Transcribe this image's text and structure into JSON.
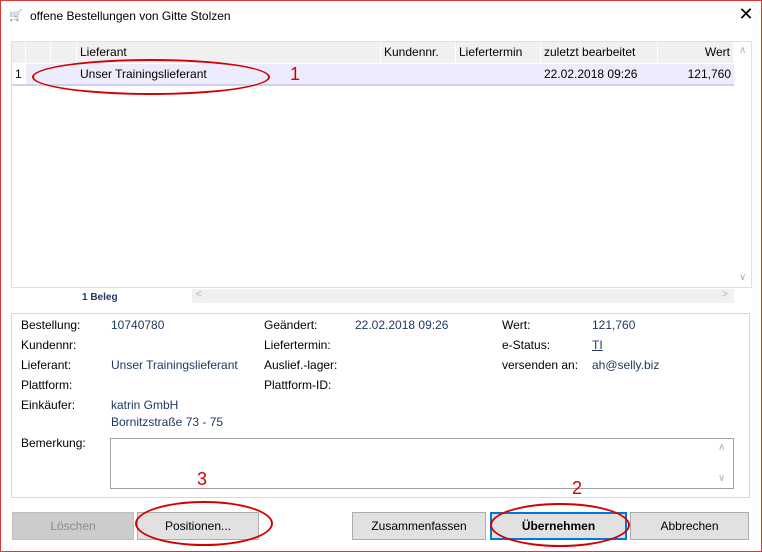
{
  "window": {
    "title": "offene Bestellungen von Gitte Stolzen",
    "close": "✕"
  },
  "grid": {
    "columns": [
      "Lieferant",
      "Kundennr.",
      "Liefertermin",
      "zuletzt bearbeitet",
      "Wert"
    ],
    "rows": [
      {
        "num": "1",
        "lieferant": "Unser Trainingslieferant",
        "kundennr": "",
        "liefertermin": "",
        "zuletzt": "22.02.2018 09:26",
        "wert": "121,760"
      }
    ],
    "count": "1 Beleg"
  },
  "details": {
    "bestellung_label": "Bestellung:",
    "bestellung": "10740780",
    "geaendert_label": "Geändert:",
    "geaendert": "22.02.2018 09:26",
    "wert_label": "Wert:",
    "wert": "121,760",
    "kundennr_label": "Kundennr:",
    "liefertermin_label": "Liefertermin:",
    "estatus_label": "e-Status:",
    "estatus": "TI",
    "lieferant_label": "Lieferant:",
    "lieferant": "Unser Trainingslieferant",
    "auslief_label": "Auslief.-lager:",
    "versenden_label": "versenden an:",
    "versenden": "ah@selly.biz",
    "plattform_label": "Plattform:",
    "plattform_id_label": "Plattform-ID:",
    "einkaeufer_label": "Einkäufer:",
    "einkaeufer_line1": "katrin GmbH",
    "einkaeufer_line2": "Bornitzstraße 73 - 75",
    "bemerkung_label": "Bemerkung:",
    "bemerkung": ""
  },
  "buttons": {
    "loeschen": "Löschen",
    "positionen": "Positionen...",
    "zusammenfassen": "Zusammenfassen",
    "uebernehmen": "Übernehmen",
    "abbrechen": "Abbrechen"
  },
  "annotations": [
    "1",
    "2",
    "3"
  ],
  "colors": {
    "accent": "#1f3864",
    "annotation": "#d40000",
    "selection": "#ececfc"
  }
}
